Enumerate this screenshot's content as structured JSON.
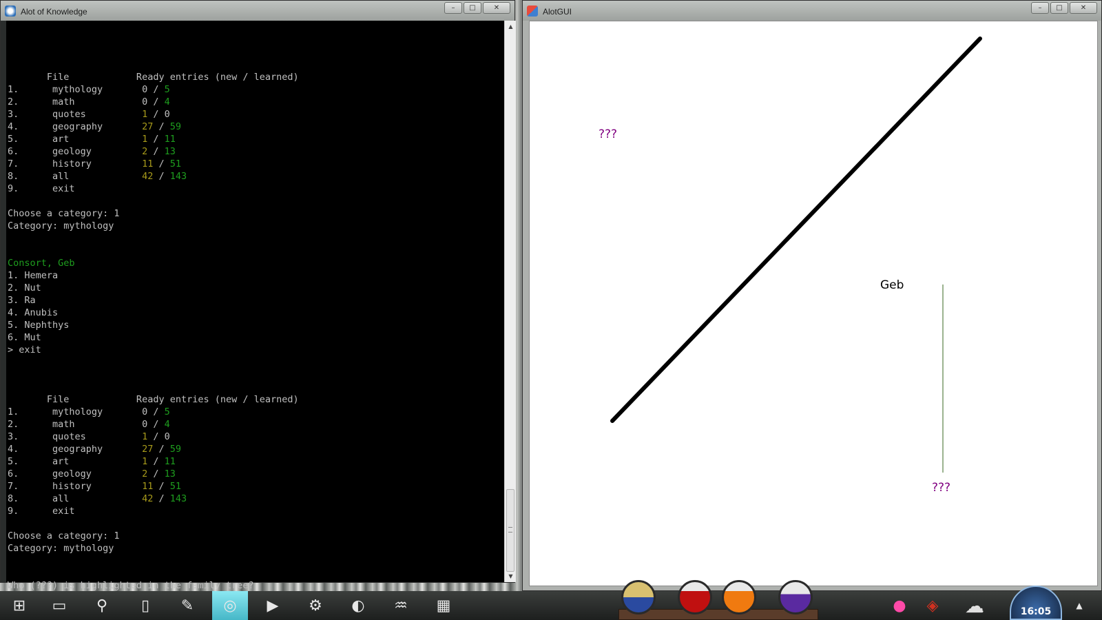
{
  "console_window": {
    "title": "Alot of Knowledge",
    "lines": [
      [
        ""
      ],
      [
        ""
      ],
      [
        {
          "t": "       File            Ready entries (new / learned)"
        }
      ],
      [
        {
          "t": "1.      mythology       0 / "
        },
        {
          "t": "5",
          "c": "g"
        }
      ],
      [
        {
          "t": "2.      math            0 / "
        },
        {
          "t": "4",
          "c": "g"
        }
      ],
      [
        {
          "t": "3.      quotes          "
        },
        {
          "t": "1",
          "c": "o"
        },
        {
          "t": " / 0"
        }
      ],
      [
        {
          "t": "4.      geography       "
        },
        {
          "t": "27",
          "c": "o"
        },
        {
          "t": " / "
        },
        {
          "t": "59",
          "c": "g"
        }
      ],
      [
        {
          "t": "5.      art             "
        },
        {
          "t": "1",
          "c": "o"
        },
        {
          "t": " / "
        },
        {
          "t": "11",
          "c": "g"
        }
      ],
      [
        {
          "t": "6.      geology         "
        },
        {
          "t": "2",
          "c": "o"
        },
        {
          "t": " / "
        },
        {
          "t": "13",
          "c": "g"
        }
      ],
      [
        {
          "t": "7.      history         "
        },
        {
          "t": "11",
          "c": "o"
        },
        {
          "t": " / "
        },
        {
          "t": "51",
          "c": "g"
        }
      ],
      [
        {
          "t": "8.      all             "
        },
        {
          "t": "42",
          "c": "o"
        },
        {
          "t": " / "
        },
        {
          "t": "143",
          "c": "g"
        }
      ],
      [
        {
          "t": "9.      exit"
        }
      ],
      [
        ""
      ],
      [
        {
          "t": "Choose a category: 1"
        }
      ],
      [
        {
          "t": "Category: mythology"
        }
      ],
      [
        ""
      ],
      [
        ""
      ],
      [
        {
          "t": "Consort, Geb",
          "c": "g"
        }
      ],
      [
        {
          "t": "1. Hemera"
        }
      ],
      [
        {
          "t": "2. Nut"
        }
      ],
      [
        {
          "t": "3. Ra"
        }
      ],
      [
        {
          "t": "4. Anubis"
        }
      ],
      [
        {
          "t": "5. Nephthys"
        }
      ],
      [
        {
          "t": "6. Mut"
        }
      ],
      [
        {
          "t": "> exit"
        }
      ],
      [
        ""
      ],
      [
        ""
      ],
      [
        ""
      ],
      [
        {
          "t": "       File            Ready entries (new / learned)"
        }
      ],
      [
        {
          "t": "1.      mythology       0 / "
        },
        {
          "t": "5",
          "c": "g"
        }
      ],
      [
        {
          "t": "2.      math            0 / "
        },
        {
          "t": "4",
          "c": "g"
        }
      ],
      [
        {
          "t": "3.      quotes          "
        },
        {
          "t": "1",
          "c": "o"
        },
        {
          "t": " / 0"
        }
      ],
      [
        {
          "t": "4.      geography       "
        },
        {
          "t": "27",
          "c": "o"
        },
        {
          "t": " / "
        },
        {
          "t": "59",
          "c": "g"
        }
      ],
      [
        {
          "t": "5.      art             "
        },
        {
          "t": "1",
          "c": "o"
        },
        {
          "t": " / "
        },
        {
          "t": "11",
          "c": "g"
        }
      ],
      [
        {
          "t": "6.      geology         "
        },
        {
          "t": "2",
          "c": "o"
        },
        {
          "t": " / "
        },
        {
          "t": "13",
          "c": "g"
        }
      ],
      [
        {
          "t": "7.      history         "
        },
        {
          "t": "11",
          "c": "o"
        },
        {
          "t": " / "
        },
        {
          "t": "51",
          "c": "g"
        }
      ],
      [
        {
          "t": "8.      all             "
        },
        {
          "t": "42",
          "c": "o"
        },
        {
          "t": " / "
        },
        {
          "t": "143",
          "c": "g"
        }
      ],
      [
        {
          "t": "9.      exit"
        }
      ],
      [
        ""
      ],
      [
        {
          "t": "Choose a category: 1"
        }
      ],
      [
        {
          "t": "Category: mythology"
        }
      ],
      [
        ""
      ],
      [
        ""
      ],
      [
        {
          "t": "Who (???) is highlighted in the family tree?"
        }
      ],
      [
        {
          "t": ">"
        }
      ]
    ],
    "colors": {
      "olive": "#a89b1b",
      "green": "#1e9e1e",
      "text": "#c0c0c0",
      "background": "#000000"
    }
  },
  "gui_window": {
    "title": "AlotGUI",
    "labels": {
      "unknown_top": "???",
      "geb": "Geb",
      "unknown_bottom": "???"
    },
    "colors": {
      "unknown": "#800080",
      "known": "#000000",
      "thin_line": "#7a9a6a",
      "thick_line": "#000000"
    }
  },
  "window_controls": {
    "minimize": "–",
    "maximize": "□",
    "close": "✕"
  },
  "taskbar": {
    "icons": [
      "start-icon",
      "computer-icon",
      "search-icon",
      "document-icon",
      "pen-icon",
      "chrome-icon",
      "play-icon",
      "steam-icon",
      "edge-icon",
      "python-icon",
      "paint-icon"
    ],
    "clock": "16:05"
  }
}
